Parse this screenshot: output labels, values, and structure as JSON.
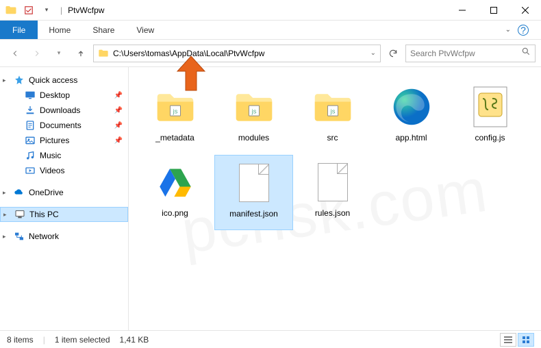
{
  "window": {
    "title": "PtvWcfpw"
  },
  "menu": {
    "file": "File",
    "home": "Home",
    "share": "Share",
    "view": "View"
  },
  "address": {
    "path": "C:\\Users\\tomas\\AppData\\Local\\PtvWcfpw",
    "search_placeholder": "Search PtvWcfpw"
  },
  "sidebar": {
    "quick_access": "Quick access",
    "desktop": "Desktop",
    "downloads": "Downloads",
    "documents": "Documents",
    "pictures": "Pictures",
    "music": "Music",
    "videos": "Videos",
    "onedrive": "OneDrive",
    "this_pc": "This PC",
    "network": "Network"
  },
  "files": [
    {
      "name": "_metadata",
      "type": "folder"
    },
    {
      "name": "modules",
      "type": "folder"
    },
    {
      "name": "src",
      "type": "folder"
    },
    {
      "name": "app.html",
      "type": "edge"
    },
    {
      "name": "config.js",
      "type": "js"
    },
    {
      "name": "ico.png",
      "type": "drive"
    },
    {
      "name": "manifest.json",
      "type": "blank",
      "selected": true
    },
    {
      "name": "rules.json",
      "type": "blank"
    }
  ],
  "status": {
    "count": "8 items",
    "selection": "1 item selected",
    "size": "1,41 KB"
  },
  "watermark": "pcrisk.com"
}
